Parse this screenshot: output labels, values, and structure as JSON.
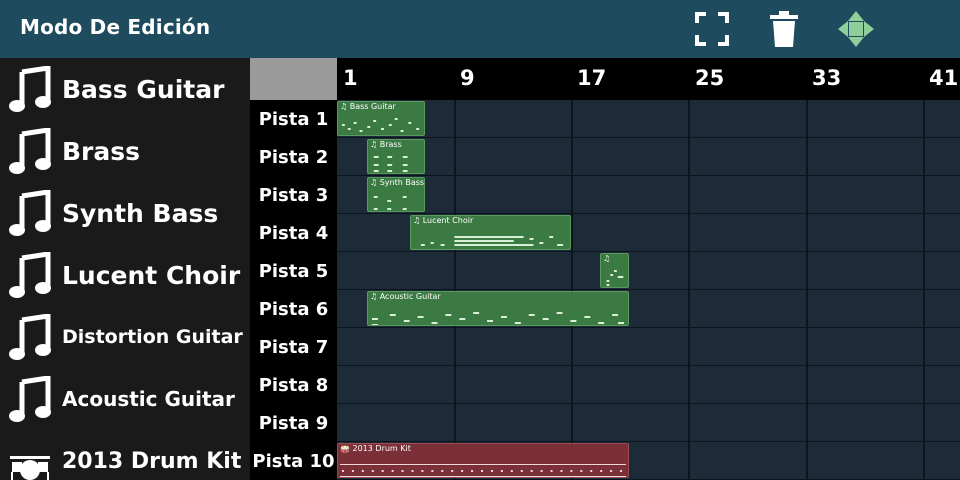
{
  "header": {
    "title": "Modo De Edición"
  },
  "instruments": [
    {
      "label": "Bass Guitar",
      "icon": "music-note-icon"
    },
    {
      "label": "Brass",
      "icon": "music-note-icon"
    },
    {
      "label": "Synth Bass",
      "icon": "music-note-icon"
    },
    {
      "label": "Lucent Choir",
      "icon": "music-note-icon"
    },
    {
      "label": "Distortion Guitar",
      "icon": "music-note-icon"
    },
    {
      "label": "Acoustic Guitar",
      "icon": "music-note-icon"
    },
    {
      "label": "2013 Drum Kit",
      "icon": "drum-kit-icon"
    }
  ],
  "ruler": [
    "1",
    "9",
    "17",
    "25",
    "33",
    "41"
  ],
  "tracks": [
    "Pista 1",
    "Pista 2",
    "Pista 3",
    "Pista 4",
    "Pista 5",
    "Pista 6",
    "Pista 7",
    "Pista 8",
    "Pista 9",
    "Pista 10"
  ],
  "clips": [
    {
      "title": "♫ Bass Guitar",
      "color": "green"
    },
    {
      "title": "♫ Brass",
      "color": "green"
    },
    {
      "title": "♫ Synth Bass",
      "color": "green"
    },
    {
      "title": "♫ Lucent Choir",
      "color": "green"
    },
    {
      "title": "♫",
      "color": "green"
    },
    {
      "title": "♫ Acoustic Guitar",
      "color": "green"
    },
    {
      "title": "🥁 2013 Drum Kit",
      "color": "red"
    }
  ],
  "colors": {
    "header": "#1e4c5e",
    "clip_green": "#3b7a43",
    "clip_red": "#7a3036",
    "grid": "#1c2b37",
    "move_icon": "#8fcf9a"
  }
}
